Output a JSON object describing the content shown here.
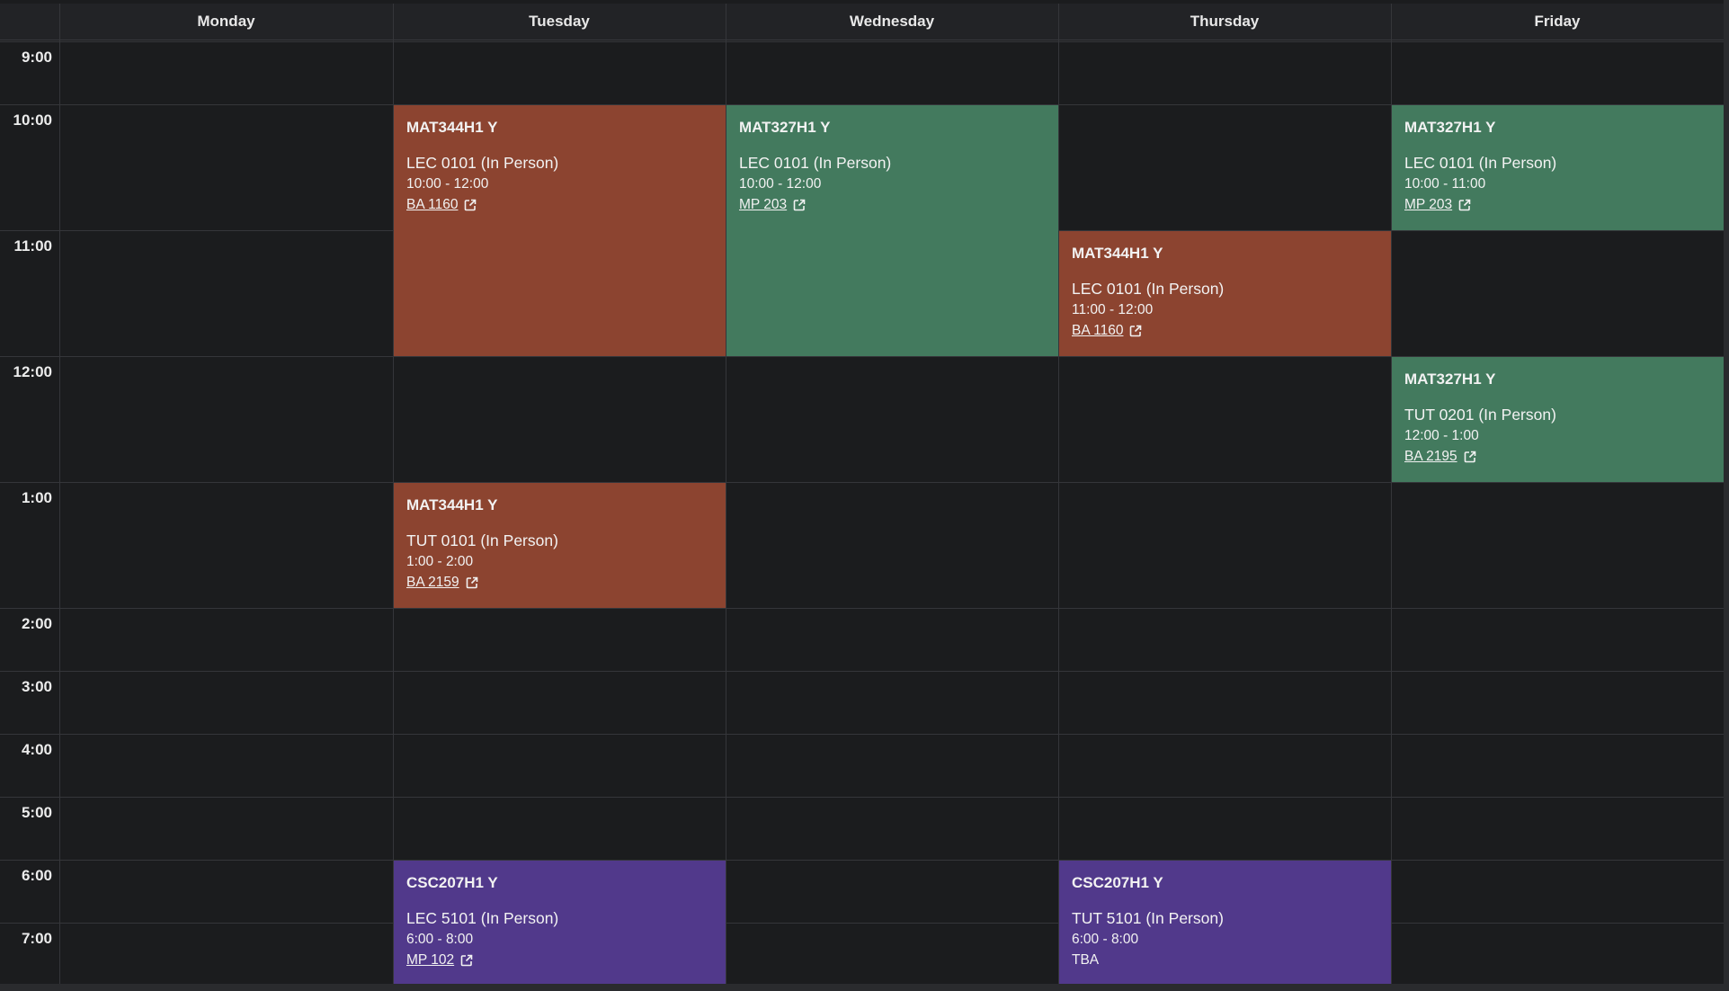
{
  "days": [
    "Monday",
    "Tuesday",
    "Wednesday",
    "Thursday",
    "Friday"
  ],
  "times": [
    "9:00",
    "10:00",
    "11:00",
    "12:00",
    "1:00",
    "2:00",
    "3:00",
    "4:00",
    "5:00",
    "6:00",
    "7:00"
  ],
  "colors": {
    "background": "#1b1c1e",
    "header": "#222326",
    "grid_line": "#35363a",
    "mat344": "#8c4430",
    "mat327": "#437a5e",
    "csc207": "#51398b"
  },
  "events": [
    {
      "id": "tue-mat344-lec",
      "day": "Tuesday",
      "code": "MAT344H1 Y",
      "section": "LEC 0101 (In Person)",
      "time": "10:00 - 12:00",
      "room": "BA 1160",
      "room_is_link": true,
      "color": "#8c4430"
    },
    {
      "id": "wed-mat327-lec",
      "day": "Wednesday",
      "code": "MAT327H1 Y",
      "section": "LEC 0101 (In Person)",
      "time": "10:00 - 12:00",
      "room": "MP 203",
      "room_is_link": true,
      "color": "#437a5e"
    },
    {
      "id": "fri-mat327-lec",
      "day": "Friday",
      "code": "MAT327H1 Y",
      "section": "LEC 0101 (In Person)",
      "time": "10:00 - 11:00",
      "room": "MP 203",
      "room_is_link": true,
      "color": "#437a5e"
    },
    {
      "id": "thu-mat344-lec",
      "day": "Thursday",
      "code": "MAT344H1 Y",
      "section": "LEC 0101 (In Person)",
      "time": "11:00 - 12:00",
      "room": "BA 1160",
      "room_is_link": true,
      "color": "#8c4430"
    },
    {
      "id": "fri-mat327-tut",
      "day": "Friday",
      "code": "MAT327H1 Y",
      "section": "TUT 0201 (In Person)",
      "time": "12:00 - 1:00",
      "room": "BA 2195",
      "room_is_link": true,
      "color": "#437a5e"
    },
    {
      "id": "tue-mat344-tut",
      "day": "Tuesday",
      "code": "MAT344H1 Y",
      "section": "TUT 0101 (In Person)",
      "time": "1:00 - 2:00",
      "room": "BA 2159",
      "room_is_link": true,
      "color": "#8c4430"
    },
    {
      "id": "tue-csc207-lec",
      "day": "Tuesday",
      "code": "CSC207H1 Y",
      "section": "LEC 5101 (In Person)",
      "time": "6:00 - 8:00",
      "room": "MP 102",
      "room_is_link": true,
      "color": "#51398b"
    },
    {
      "id": "thu-csc207-tut",
      "day": "Thursday",
      "code": "CSC207H1 Y",
      "section": "TUT 5101 (In Person)",
      "time": "6:00 - 8:00",
      "room": "TBA",
      "room_is_link": false,
      "color": "#51398b"
    }
  ],
  "icons": {
    "room_link_icon": "external-link-icon"
  }
}
